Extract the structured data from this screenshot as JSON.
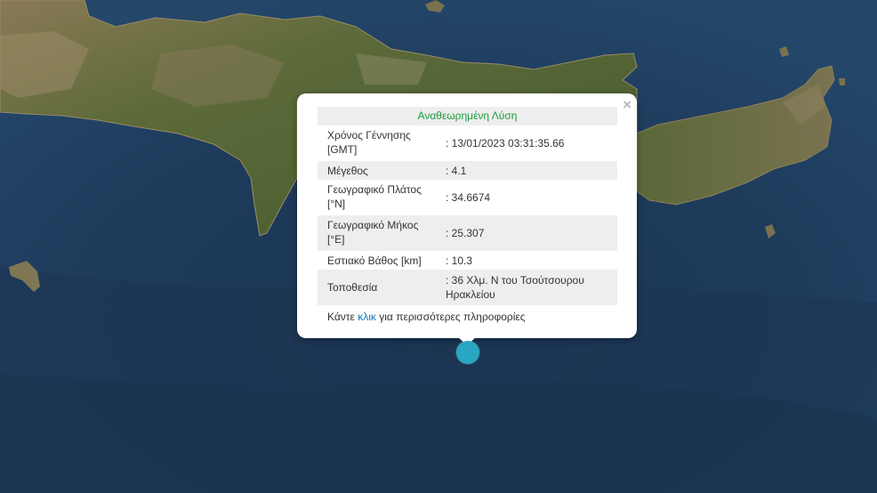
{
  "popup": {
    "title": "Αναθεωρημένη Λύση",
    "close_symbol": "×",
    "rows": [
      {
        "label": "Χρόνος Γέννησης [GMT]",
        "value": ": 13/01/2023 03:31:35.66"
      },
      {
        "label": "Μέγεθος",
        "value": ": 4.1"
      },
      {
        "label": "Γεωγραφικό Πλάτος [°N]",
        "value": ": 34.6674"
      },
      {
        "label": "Γεωγραφικό Μήκος [°E]",
        "value": ": 25.307"
      },
      {
        "label": "Εστιακό Βάθος [km]",
        "value": ": 10.3"
      },
      {
        "label": "Τοποθεσία",
        "value": ": 36 Χλμ. Ν του Τσούτσουρου Ηρακλείου"
      }
    ],
    "more_prefix": "Κάντε",
    "more_link": "κλικ",
    "more_suffix": "για περισσότερες πληροφορίες"
  },
  "marker": {
    "icon": "earthquake-marker-icon",
    "color": "#29a7c2"
  },
  "colors": {
    "sea": "#1d3a5a",
    "land": "#5f6b3a",
    "title_green": "#1a9c3b",
    "link_blue": "#1277b7"
  }
}
